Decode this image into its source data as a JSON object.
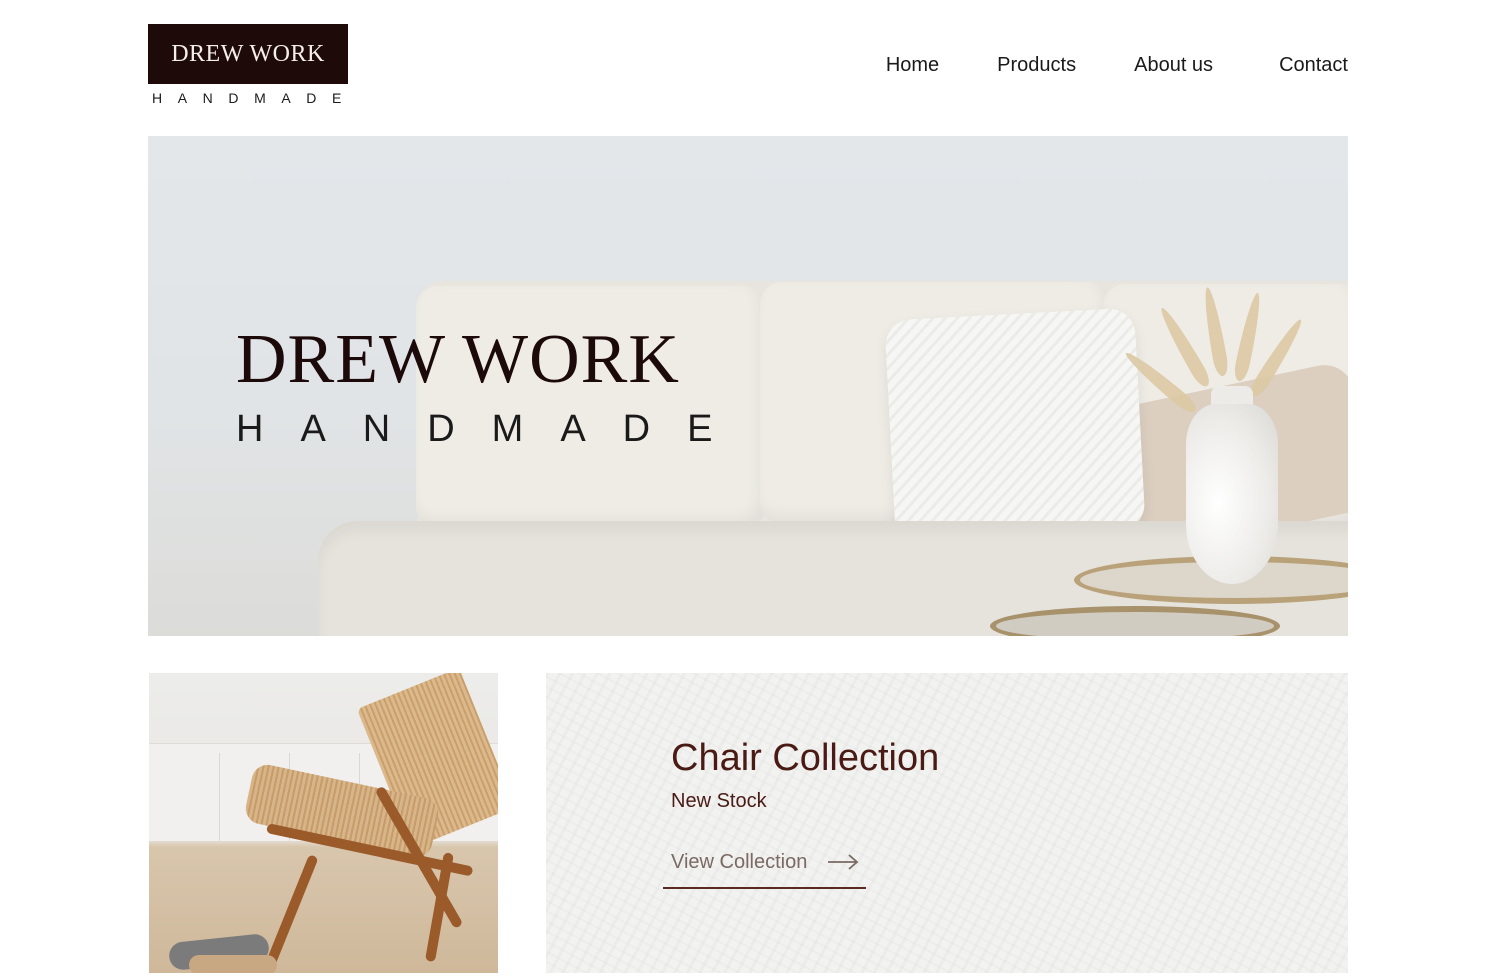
{
  "header": {
    "logo": {
      "title": "DREW WORK",
      "subtitle": "HANDMADE"
    },
    "nav": [
      {
        "label": "Home"
      },
      {
        "label": "Products"
      },
      {
        "label": "About us"
      },
      {
        "label": "Contact"
      }
    ]
  },
  "hero": {
    "title": "DREW WORK",
    "subtitle": "HANDMADE"
  },
  "collection": {
    "title": "Chair Collection",
    "subtitle": "New Stock",
    "link_label": "View Collection",
    "link_icon": "arrow-right-icon"
  },
  "colors": {
    "brand_dark": "#1f0a0a",
    "accent": "#4a1a14",
    "muted_link": "#7a6a62"
  }
}
